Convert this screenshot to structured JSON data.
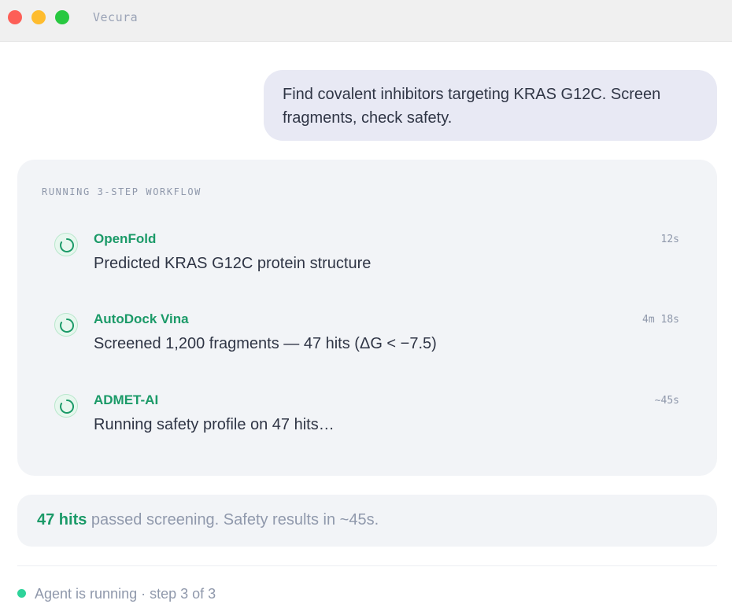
{
  "window": {
    "title": "Vecura"
  },
  "message": {
    "text": "Find covalent inhibitors targeting KRAS G12C. Screen fragments, check safety."
  },
  "workflow": {
    "header": "RUNNING 3-STEP WORKFLOW",
    "steps": [
      {
        "name": "OpenFold",
        "time": "12s",
        "description": "Predicted KRAS G12C protein structure",
        "icon": "spinner-icon"
      },
      {
        "name": "AutoDock Vina",
        "time": "4m 18s",
        "description": "Screened 1,200 fragments — 47 hits (ΔG < −7.5)",
        "icon": "spinner-icon"
      },
      {
        "name": "ADMET-AI",
        "time": "~45s",
        "description": "Running safety profile on 47 hits…",
        "icon": "spinner-icon"
      }
    ]
  },
  "summary": {
    "hits": "47 hits",
    "rest": " passed screening. Safety results in ~45s."
  },
  "status": {
    "text": "Agent is running · step 3 of 3"
  },
  "colors": {
    "accent": "#1b9a68",
    "status_dot": "#2ed39a",
    "bubble": "#e8e9f4",
    "panel": "#f2f4f7"
  }
}
